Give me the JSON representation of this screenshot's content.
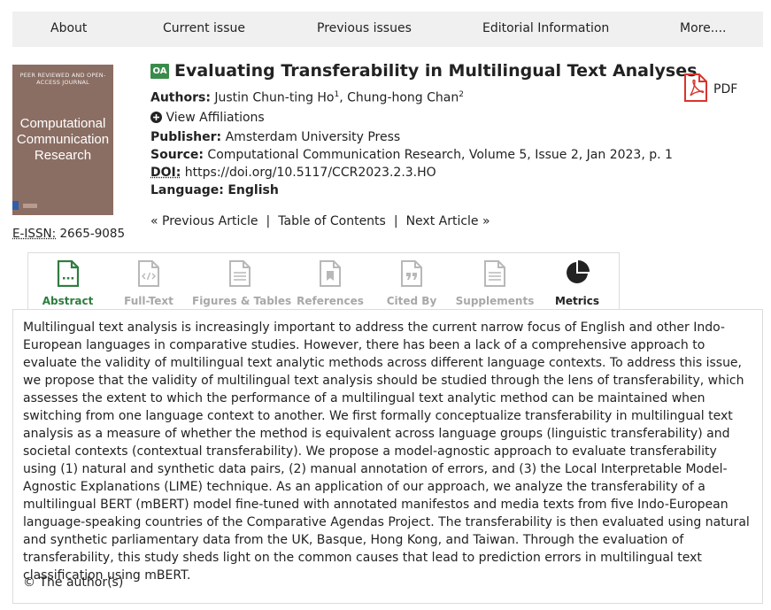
{
  "nav": {
    "items": [
      "About",
      "Current issue",
      "Previous issues",
      "Editorial Information",
      "More...."
    ]
  },
  "cover": {
    "kicker": "PEER REVIEWED AND OPEN-ACCESS JOURNAL",
    "title": "Computational Communication Research"
  },
  "issn": {
    "label": "E-ISSN:",
    "value": "2665-9085"
  },
  "article": {
    "oa_badge": "OA",
    "title": "Evaluating Transferability in Multilingual Text Analyses",
    "authors_label": "Authors:",
    "author1": "Justin Chun-ting Ho",
    "author1_sup": "1",
    "author2": "Chung-hong Chan",
    "author2_sup": "2",
    "view_affiliations": "View Affiliations",
    "publisher_label": "Publisher:",
    "publisher": "Amsterdam University Press",
    "source_label": "Source:",
    "source": "Computational Communication Research, Volume 5, Issue 2, Jan 2023, p. 1",
    "doi_label": "DOI:",
    "doi": "https://doi.org/10.5117/CCR2023.2.3.HO",
    "language_label": "Language:",
    "language": "English",
    "pdf_label": "PDF"
  },
  "article_nav": {
    "previous": "« Previous Article",
    "separator": "|",
    "toc": "Table of Contents",
    "next": "Next Article »"
  },
  "tabs": [
    {
      "label": "Abstract",
      "icon": "document-icon",
      "state": "active"
    },
    {
      "label": "Full-Text",
      "icon": "code-document-icon",
      "state": "disabled"
    },
    {
      "label": "Figures & Tables",
      "icon": "document-lines-icon",
      "state": "disabled"
    },
    {
      "label": "References",
      "icon": "bookmark-document-icon",
      "state": "disabled"
    },
    {
      "label": "Cited By",
      "icon": "quote-document-icon",
      "state": "disabled"
    },
    {
      "label": "Supplements",
      "icon": "document-lines-icon",
      "state": "disabled"
    },
    {
      "label": "Metrics",
      "icon": "pie-chart-icon",
      "state": "enabled"
    }
  ],
  "abstract": "Multilingual text analysis is increasingly important to address the current narrow focus of English and other Indo-European languages in comparative studies. However, there has been a lack of a comprehensive approach to evaluate the validity of multilingual text analytic methods across different language contexts. To address this issue, we propose that the validity of multilingual text analysis should be studied through the lens of transferability, which assesses the extent to which the performance of a multilingual text analytic method can be maintained when switching from one language context to another. We first formally conceptualize transferability in multilingual text analysis as a measure of whether the method is equivalent across language groups (linguistic transferability) and societal contexts (contextual transferability). We propose a model-agnostic approach to evaluate transferability using (1) natural and synthetic data pairs, (2) manual annotation of errors, and (3) the Local Interpretable Model-Agnostic Explanations (LIME) technique. As an application of our approach, we analyze the transferability of a multilingual BERT (mBERT) model fine-tuned with annotated manifestos and media texts from five Indo-European language-speaking countries of the Comparative Agendas Project. The transferability is then evaluated using natural and synthetic parliamentary data from the UK, Basque, Hong Kong, and Taiwan. Through the evaluation of transferability, this study sheds light on the common causes that lead to prediction errors in multilingual text classification using mBERT.",
  "copyright": "© The author(s)",
  "colors": {
    "accent_green": "#2e7d3e",
    "oa_green": "#3a8c4a",
    "pdf_red": "#d9342b",
    "cover_brown": "#8b6e63"
  }
}
